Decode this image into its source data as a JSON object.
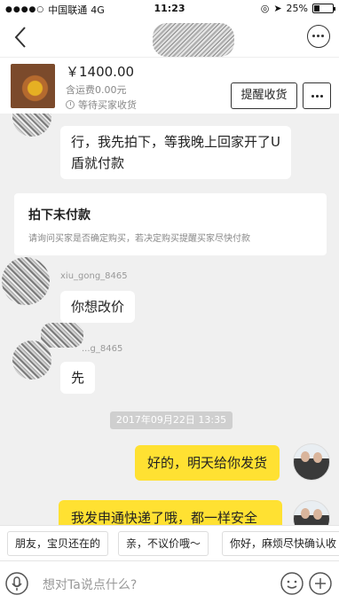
{
  "status_bar": {
    "carrier": "中国联通",
    "network": "4G",
    "time": "11:23",
    "battery": "25%",
    "battery_level": 0.25
  },
  "product": {
    "price": "￥1400.00",
    "shipping": "含运费0.00元",
    "state": "等待买家收货",
    "remind_button": "提醒收货"
  },
  "chat": {
    "msg1": "行，我先拍下，等我晚上回家开了U盾就付款",
    "order_card": {
      "title": "拍下未付款",
      "desc": "请询问买家是否确定购买，若决定购买提醒买家尽快付款"
    },
    "user1_name": "xiu_gong_8465",
    "msg2": "你想改价",
    "user2_name": "...g_8465",
    "msg3": "先",
    "timestamp": "2017年09月22日 13:35",
    "msg4": "好的，明天给你发货",
    "msg5": "我发申通快递了哦，都一样安全的"
  },
  "quick_replies": [
    "朋友，宝贝还在的",
    "亲，不议价哦～",
    "你好，麻烦尽快确认收"
  ],
  "input": {
    "placeholder": "想对Ta说点什么?"
  }
}
